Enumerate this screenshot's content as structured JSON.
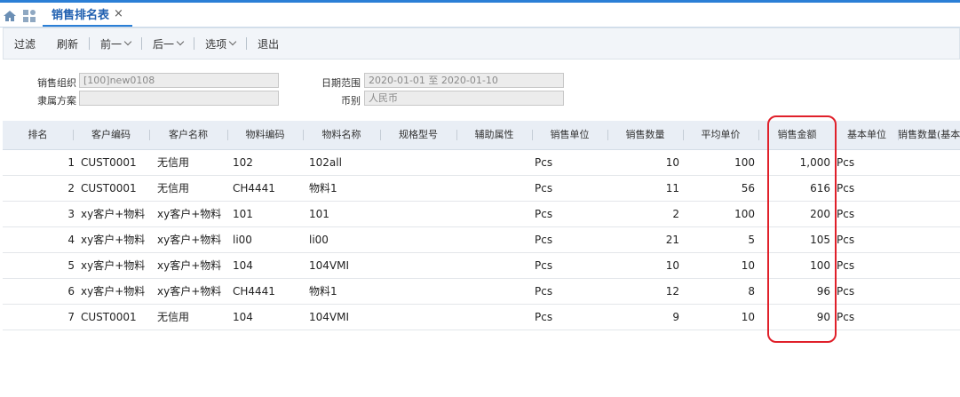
{
  "tab": {
    "title": "销售排名表",
    "close": "×"
  },
  "toolbar": {
    "items": [
      {
        "label": "过滤",
        "dropdown": false
      },
      {
        "label": "刷新",
        "dropdown": false
      },
      {
        "label": "前一",
        "dropdown": true
      },
      {
        "label": "后一",
        "dropdown": true
      },
      {
        "label": "选项",
        "dropdown": true
      },
      {
        "label": "退出",
        "dropdown": false
      }
    ]
  },
  "filters": {
    "sales_org_label": "销售组织",
    "sales_org_value": "[100]new0108",
    "scheme_label": "隶属方案",
    "scheme_value": "",
    "date_range_label": "日期范围",
    "date_range_value": "2020-01-01 至 2020-01-10",
    "currency_label": "币别",
    "currency_value": "人民币"
  },
  "table": {
    "columns": [
      "排名",
      "客户编码",
      "客户名称",
      "物料编码",
      "物料名称",
      "规格型号",
      "辅助属性",
      "销售单位",
      "销售数量",
      "平均单价",
      "销售金额",
      "基本单位",
      "销售数量(基本"
    ],
    "rows": [
      [
        "1",
        "CUST0001",
        "无信用",
        "102",
        "102all",
        "",
        "",
        "Pcs",
        "10",
        "100",
        "1,000",
        "Pcs"
      ],
      [
        "2",
        "CUST0001",
        "无信用",
        "CH4441",
        "物料1",
        "",
        "",
        "Pcs",
        "11",
        "56",
        "616",
        "Pcs"
      ],
      [
        "3",
        "xy客户+物料",
        "xy客户+物料",
        "101",
        "101",
        "",
        "",
        "Pcs",
        "2",
        "100",
        "200",
        "Pcs"
      ],
      [
        "4",
        "xy客户+物料",
        "xy客户+物料",
        "li00",
        "li00",
        "",
        "",
        "Pcs",
        "21",
        "5",
        "105",
        "Pcs"
      ],
      [
        "5",
        "xy客户+物料",
        "xy客户+物料",
        "104",
        "104VMI",
        "",
        "",
        "Pcs",
        "10",
        "10",
        "100",
        "Pcs"
      ],
      [
        "6",
        "xy客户+物料",
        "xy客户+物料",
        "CH4441",
        "物料1",
        "",
        "",
        "Pcs",
        "12",
        "8",
        "96",
        "Pcs"
      ],
      [
        "7",
        "CUST0001",
        "无信用",
        "104",
        "104VMI",
        "",
        "",
        "Pcs",
        "9",
        "10",
        "90",
        "Pcs"
      ]
    ]
  },
  "colors": {
    "accent": "#2b7fd6",
    "highlight": "#e0202a"
  }
}
